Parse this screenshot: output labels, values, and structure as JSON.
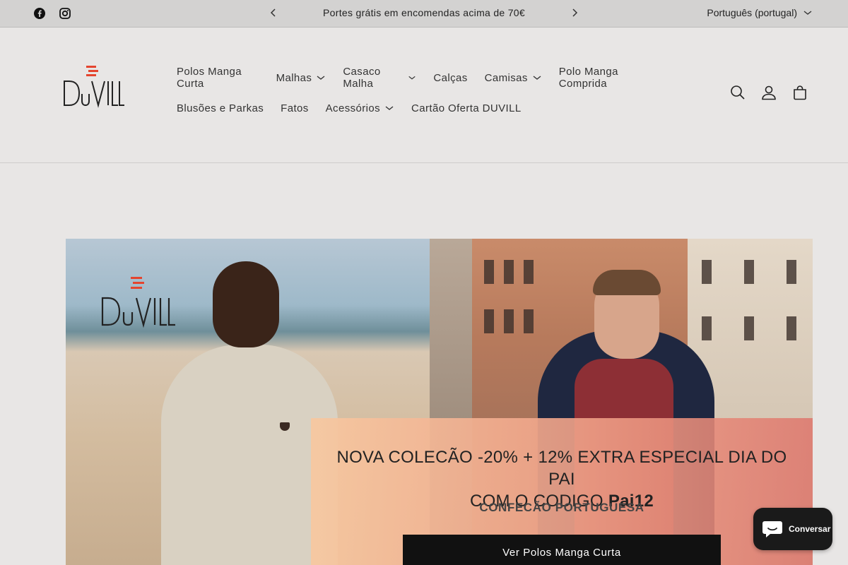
{
  "announcement": {
    "text": "Portes grátis em encomendas acima de 70€",
    "language": "Português (portugal)"
  },
  "header": {
    "logo_text": "DuVILL",
    "nav_row1": [
      "Polos Manga Curta",
      "Malhas",
      "Casaco Malha",
      "Calças",
      "Camisas",
      "Polo Manga Comprida"
    ],
    "nav_row2": [
      "Blusões e Parkas",
      "Fatos",
      "Acessórios",
      "Cartão Oferta DUVILL"
    ]
  },
  "hero": {
    "logo_text": "DuVILL",
    "title_line1": "NOVA COLECÃO -20% + 12% EXTRA ESPECIAL DIA DO PAI",
    "title_line2_prefix": "COM O CODIGO ",
    "title_code": "Pai12",
    "subtitle": "CONFECÃO PORTUGUESA",
    "button_label": "Ver Polos Manga Curta"
  },
  "chat": {
    "label": "Conversar"
  },
  "colors": {
    "accent": "#e4452f",
    "button_bg": "#111111",
    "page_bg": "#e8e6e5"
  },
  "icons": [
    "facebook-icon",
    "instagram-icon",
    "chevron-left-icon",
    "chevron-right-icon",
    "chevron-down-icon",
    "search-icon",
    "account-icon",
    "cart-icon",
    "chat-icon"
  ]
}
